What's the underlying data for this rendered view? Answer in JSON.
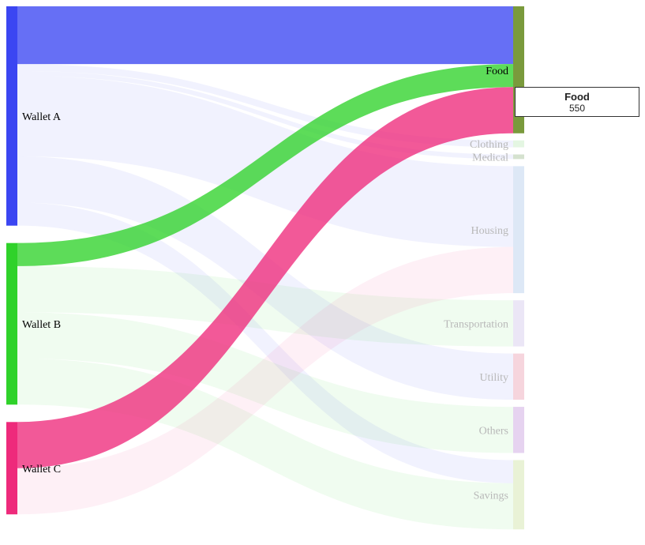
{
  "chart_data": {
    "type": "sankey",
    "sources": [
      {
        "name": "Wallet A",
        "color": "#3b46f2"
      },
      {
        "name": "Wallet B",
        "color": "#2fd22a"
      },
      {
        "name": "Wallet C",
        "color": "#ee2a7b"
      }
    ],
    "targets": [
      {
        "name": "Food",
        "color": "#7a9a3c"
      },
      {
        "name": "Clothing",
        "color": "#e4f6e2"
      },
      {
        "name": "Medical",
        "color": "#d5e2cf"
      },
      {
        "name": "Housing",
        "color": "#dde8f6"
      },
      {
        "name": "Transportation",
        "color": "#ebe6f6"
      },
      {
        "name": "Utility",
        "color": "#f6d5dd"
      },
      {
        "name": "Others",
        "color": "#e6d3f0"
      },
      {
        "name": "Savings",
        "color": "#e9f2d6"
      }
    ],
    "links": [
      {
        "source": "Wallet A",
        "target": "Food",
        "value": 250
      },
      {
        "source": "Wallet A",
        "target": "Clothing",
        "value": 30
      },
      {
        "source": "Wallet A",
        "target": "Medical",
        "value": 20
      },
      {
        "source": "Wallet A",
        "target": "Housing",
        "value": 350
      },
      {
        "source": "Wallet A",
        "target": "Utility",
        "value": 200
      },
      {
        "source": "Wallet A",
        "target": "Savings",
        "value": 100
      },
      {
        "source": "Wallet B",
        "target": "Food",
        "value": 100
      },
      {
        "source": "Wallet B",
        "target": "Transportation",
        "value": 200
      },
      {
        "source": "Wallet B",
        "target": "Others",
        "value": 200
      },
      {
        "source": "Wallet B",
        "target": "Savings",
        "value": 200
      },
      {
        "source": "Wallet C",
        "target": "Food",
        "value": 200
      },
      {
        "source": "Wallet C",
        "target": "Housing",
        "value": 200
      }
    ],
    "highlighted": "Food"
  },
  "tooltip": {
    "title": "Food",
    "value": "550"
  }
}
